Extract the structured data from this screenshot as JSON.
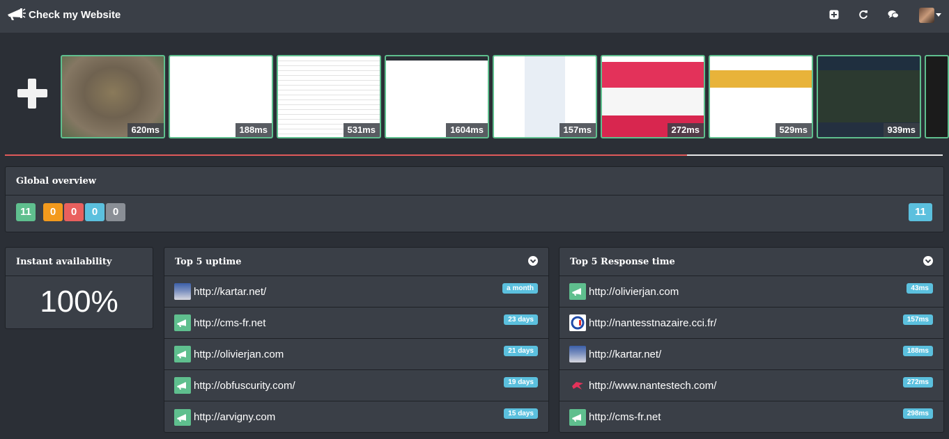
{
  "navbar": {
    "title": "Check my Website",
    "icons": [
      "plus-square-icon",
      "refresh-icon",
      "comments-icon"
    ]
  },
  "colors": {
    "success": "#5cb85c",
    "warning": "#f0ad4e",
    "danger": "#d9534f",
    "info": "#5bc0de",
    "default": "#777777",
    "accent_line": "#e05a5a"
  },
  "screenshots": [
    {
      "ms": "620ms",
      "theme": "brown"
    },
    {
      "ms": "188ms",
      "theme": "white"
    },
    {
      "ms": "531ms",
      "theme": "white-text"
    },
    {
      "ms": "1604ms",
      "theme": "news"
    },
    {
      "ms": "157ms",
      "theme": "portal"
    },
    {
      "ms": "272ms",
      "theme": "pink"
    },
    {
      "ms": "529ms",
      "theme": "colorful"
    },
    {
      "ms": "939ms",
      "theme": "dark"
    },
    {
      "ms": "",
      "theme": "dark-text"
    }
  ],
  "progress_fraction": 0.727,
  "global_overview": {
    "title": "Global overview",
    "counts": [
      {
        "value": "11",
        "status": "success"
      },
      {
        "value": "0",
        "status": "warning"
      },
      {
        "value": "0",
        "status": "danger"
      },
      {
        "value": "0",
        "status": "info"
      },
      {
        "value": "0",
        "status": "default"
      }
    ],
    "total": "11"
  },
  "instant_availability": {
    "title": "Instant availability",
    "value": "100%"
  },
  "top_uptime": {
    "title": "Top 5 uptime",
    "rows": [
      {
        "url": "http://kartar.net/",
        "badge": "a month",
        "icon": "kartar-favicon-icon"
      },
      {
        "url": "http://cms-fr.net",
        "badge": "23 days",
        "icon": "megaphone-icon"
      },
      {
        "url": "http://olivierjan.com",
        "badge": "21 days",
        "icon": "megaphone-icon"
      },
      {
        "url": "http://obfuscurity.com/",
        "badge": "19 days",
        "icon": "megaphone-icon"
      },
      {
        "url": "http://arvigny.com",
        "badge": "15 days",
        "icon": "megaphone-icon"
      }
    ]
  },
  "top_response": {
    "title": "Top 5 Response time",
    "rows": [
      {
        "url": "http://olivierjan.com",
        "badge": "43ms",
        "icon": "megaphone-icon"
      },
      {
        "url": "http://nantesstnazaire.cci.fr/",
        "badge": "157ms",
        "icon": "cci-favicon-icon"
      },
      {
        "url": "http://kartar.net/",
        "badge": "188ms",
        "icon": "kartar-favicon-icon"
      },
      {
        "url": "http://www.nantestech.com/",
        "badge": "272ms",
        "icon": "nantestech-favicon-icon"
      },
      {
        "url": "http://cms-fr.net",
        "badge": "298ms",
        "icon": "megaphone-icon"
      }
    ]
  }
}
